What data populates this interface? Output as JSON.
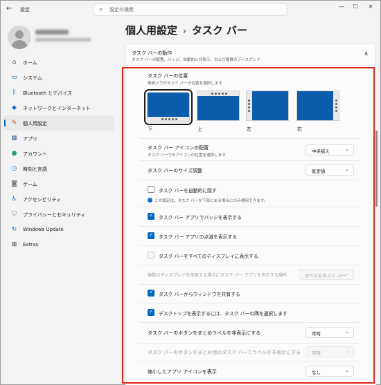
{
  "window": {
    "title": "設定",
    "controls": [
      "—",
      "☐",
      "✕"
    ]
  },
  "search": {
    "placeholder": "設定の検索"
  },
  "sidebar": {
    "items": [
      {
        "label": "ホーム",
        "icon": "home-icon",
        "glyph": "⌂",
        "color": "#555555"
      },
      {
        "label": "システム",
        "icon": "system-icon",
        "glyph": "▭",
        "color": "#0067c0"
      },
      {
        "label": "Bluetooth とデバイス",
        "icon": "bluetooth-icon",
        "glyph": "ᛒ",
        "color": "#0067c0"
      },
      {
        "label": "ネットワークとインターネット",
        "icon": "network-icon",
        "glyph": "◆",
        "color": "#1f6fcf"
      },
      {
        "label": "個人用設定",
        "icon": "personalize-icon",
        "glyph": "✎",
        "color": "#c05a2a",
        "active": true
      },
      {
        "label": "アプリ",
        "icon": "apps-icon",
        "glyph": "▦",
        "color": "#4a6fa5"
      },
      {
        "label": "アカウント",
        "icon": "account-icon",
        "glyph": "●",
        "color": "#2aa06a"
      },
      {
        "label": "時刻と言語",
        "icon": "time-language-icon",
        "glyph": "◷",
        "color": "#1f7fd0"
      },
      {
        "label": "ゲーム",
        "icon": "gaming-icon",
        "glyph": "◙",
        "color": "#777777"
      },
      {
        "label": "アクセシビリティ",
        "icon": "accessibility-icon",
        "glyph": "♿",
        "color": "#1f6fcf"
      },
      {
        "label": "プライバシーとセキュリティ",
        "icon": "shield-icon",
        "glyph": "⛉",
        "color": "#6a6a6a"
      },
      {
        "label": "Windows Update",
        "icon": "windows-update-icon",
        "glyph": "↻",
        "color": "#0067c0"
      },
      {
        "label": "Extras",
        "icon": "extras-icon",
        "glyph": "⊞",
        "color": "#333333"
      }
    ]
  },
  "breadcrumb": {
    "parent": "個人用設定",
    "separator": "›",
    "current": "タスク バー"
  },
  "section": {
    "title": "タスク バーの動作",
    "subtitle": "タスク バーの配置、バッジ、自動的に非表示、および複数のディスプレイ",
    "chevron": "∧"
  },
  "position": {
    "title": "タスク バーの位置",
    "subtitle": "画面上でのタスク バーの位置を選択します",
    "options": [
      "下",
      "上",
      "左",
      "右"
    ],
    "selected": "下"
  },
  "alignment": {
    "label": "タスク バー アイコンの配置",
    "subtitle": "タスク バーでのアイコンの位置を選択します",
    "value": "中央揃え"
  },
  "size": {
    "label": "タスク バーのサイズ調整",
    "value": "既定値"
  },
  "autohide": {
    "label": "タスク バーを自動的に隠す",
    "checked": false,
    "info": "この設定は、タスク バーが下部にある場合にのみ使用できます。"
  },
  "badges": {
    "label": "タスク バー アプリでバッジを表示する",
    "checked": true
  },
  "flashing": {
    "label": "タスク バー アプリの点滅を表示する",
    "checked": true
  },
  "all_displays": {
    "label": "タスク バーをすべてのディスプレイに表示する",
    "checked": false,
    "disabled": true
  },
  "multi_display": {
    "label": "複数のディスプレイを使用する場合にタスク バー アプリを表示する場所",
    "value": "すべてのタスク バー",
    "disabled": true
  },
  "share_window": {
    "label": "タスク バーからウィンドウを共有する",
    "checked": true
  },
  "desktop_corner": {
    "label": "デスクトップを表示するには、タスク バーの隅を選択します",
    "checked": true
  },
  "combine": {
    "label": "タスク バーのボタンをまとめラベルを非表示にする",
    "value": "常時"
  },
  "combine_other": {
    "label": "タスク バーのボタンをまとめ他のタスク バーでラベルを非表示にする",
    "value": "常時",
    "disabled": true
  },
  "minimized": {
    "label": "縮小したアプリ アイコンを表示",
    "value": "なし"
  }
}
